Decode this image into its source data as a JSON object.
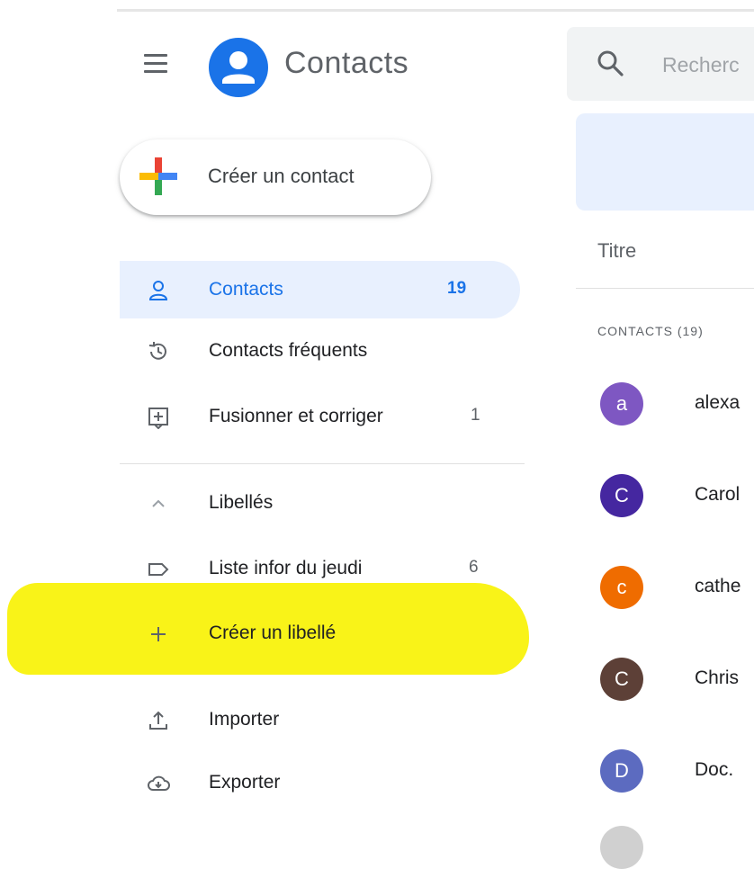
{
  "app": {
    "title": "Contacts"
  },
  "search": {
    "placeholder": "Recherc"
  },
  "create_contact": {
    "label": "Créer un contact"
  },
  "nav": {
    "contacts": {
      "label": "Contacts",
      "count": "19"
    },
    "frequent": {
      "label": "Contacts fréquents"
    },
    "merge": {
      "label": "Fusionner et corriger",
      "count": "1"
    },
    "labels_header": {
      "label": "Libellés"
    },
    "label_item": {
      "label": "Liste infor du jeudi",
      "count": "6"
    },
    "create_label": {
      "label": "Créer un libellé"
    },
    "import": {
      "label": "Importer"
    },
    "export": {
      "label": "Exporter"
    }
  },
  "list": {
    "column_title": "Titre",
    "section_label": "CONTACTS (19)",
    "rows": [
      {
        "initial": "a",
        "name": "alexa",
        "color": "#7e57c2"
      },
      {
        "initial": "C",
        "name": "Carol",
        "color": "#4527a0"
      },
      {
        "initial": "c",
        "name": "cathe",
        "color": "#ef6c00"
      },
      {
        "initial": "C",
        "name": "Chris",
        "color": "#5d4037"
      },
      {
        "initial": "D",
        "name": "Doc.",
        "color": "#5c6bc0"
      }
    ]
  },
  "colors": {
    "accent": "#1a73e8",
    "active_background": "#e8f0fe",
    "highlighter": "#f9f20c"
  }
}
